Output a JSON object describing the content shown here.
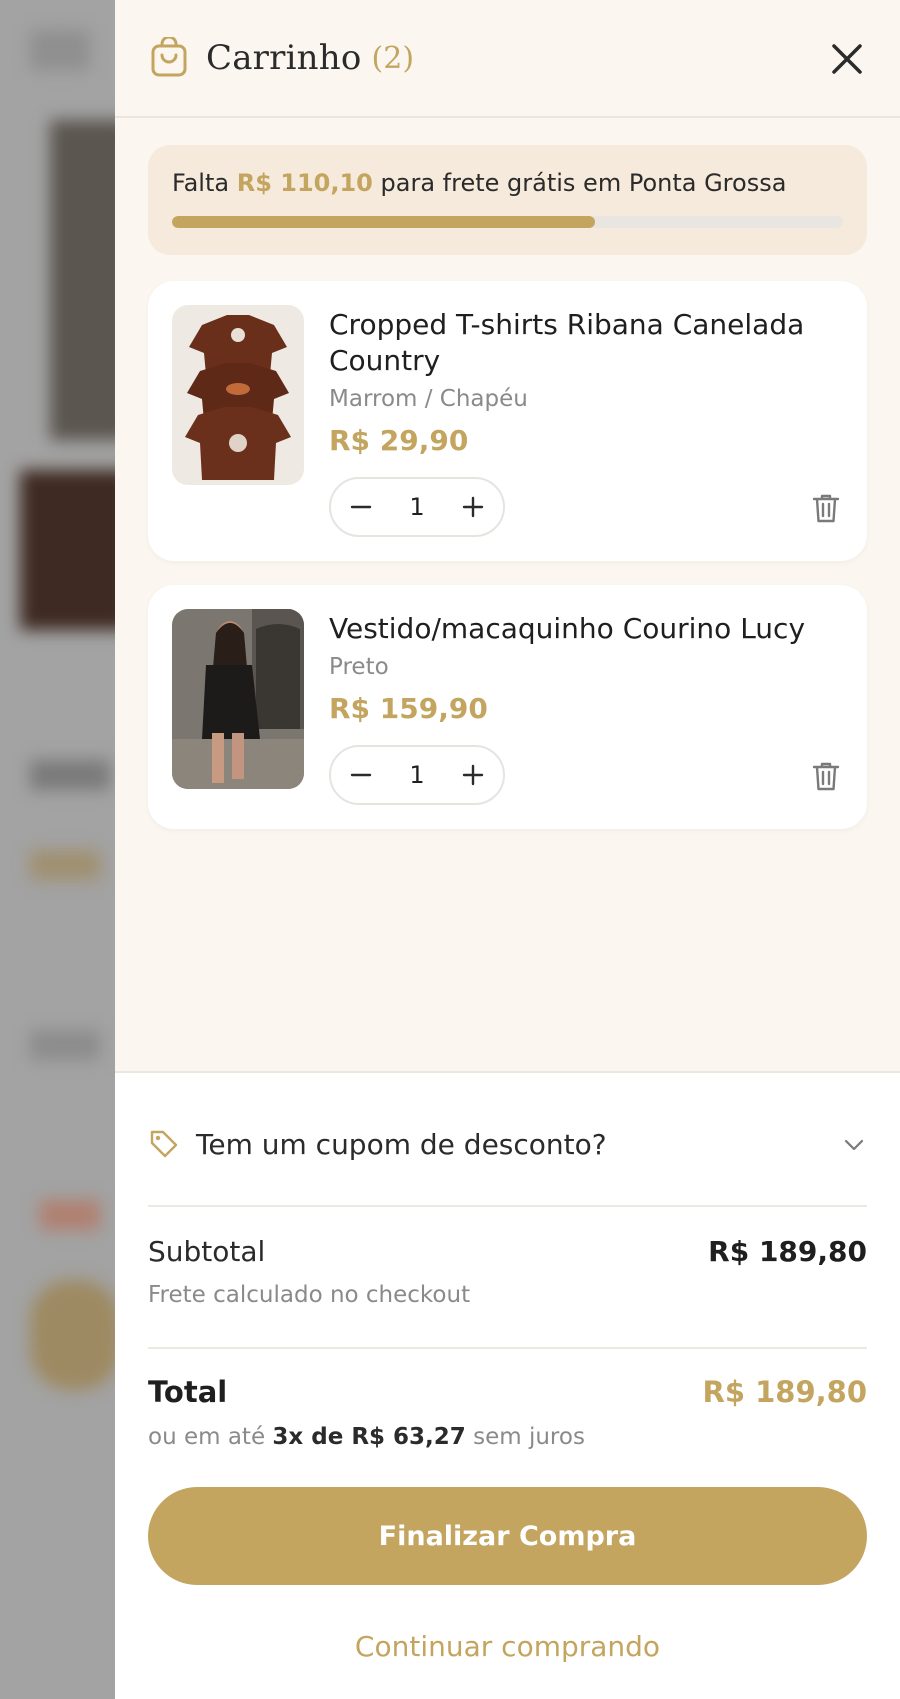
{
  "header": {
    "title": "Carrinho",
    "count": "(2)",
    "cart_icon": "shopping-bag-icon",
    "close_icon": "close-icon"
  },
  "shipping": {
    "prefix": "Falta",
    "amount": "R$ 110,10",
    "suffix": "para frete grátis em Ponta Grossa",
    "progress": 0.63
  },
  "items": [
    {
      "name": "Cropped T-shirts Ribana Canelada Country",
      "variant": "Marrom / Chapéu",
      "price": "R$ 29,90",
      "quantity": "1"
    },
    {
      "name": "Vestido/macaquinho Courino Lucy",
      "variant": "Preto",
      "price": "R$ 159,90",
      "quantity": "1"
    }
  ],
  "coupon": {
    "label": "Tem um cupom de desconto?",
    "icon": "tag-icon"
  },
  "summary": {
    "subtotal_label": "Subtotal",
    "subtotal_value": "R$ 189,80",
    "shipping_note": "Frete calculado no checkout",
    "total_label": "Total",
    "total_value": "R$ 189,80",
    "installments_prefix": "ou em até",
    "installments_value": "3x de R$ 63,27",
    "installments_suffix": "sem juros"
  },
  "actions": {
    "checkout_label": "Finalizar Compra",
    "continue_label": "Continuar comprando"
  },
  "colors": {
    "accent": "#c4a560",
    "drawer_bg": "#fbf6f0",
    "shipping_bg": "#f5eadb"
  }
}
